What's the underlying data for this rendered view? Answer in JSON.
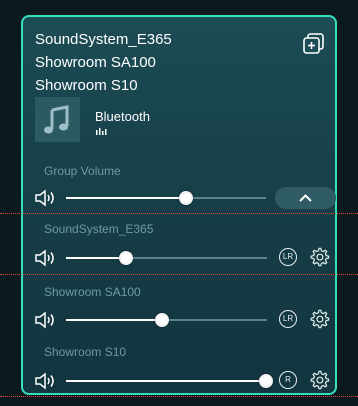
{
  "header": {
    "titles": [
      "SoundSystem_E365",
      "Showroom SA100",
      "Showroom S10"
    ]
  },
  "source": {
    "label": "Bluetooth",
    "icons": {
      "album": "music-note-icon",
      "playing": "equalizer-icon",
      "group": "group-speakers-icon"
    }
  },
  "group_volume": {
    "label": "Group Volume",
    "level": 0.6
  },
  "speakers": [
    {
      "name": "SoundSystem_E365",
      "channel": "LR",
      "level": 0.3
    },
    {
      "name": "Showroom SA100",
      "channel": "LR",
      "level": 0.48
    },
    {
      "name": "Showroom S10",
      "channel": "R",
      "level": 1.0
    }
  ],
  "colors": {
    "accent_border": "#36e0b8",
    "panel_bg": "#1c4c55",
    "divider_marker": "#e0443d"
  }
}
